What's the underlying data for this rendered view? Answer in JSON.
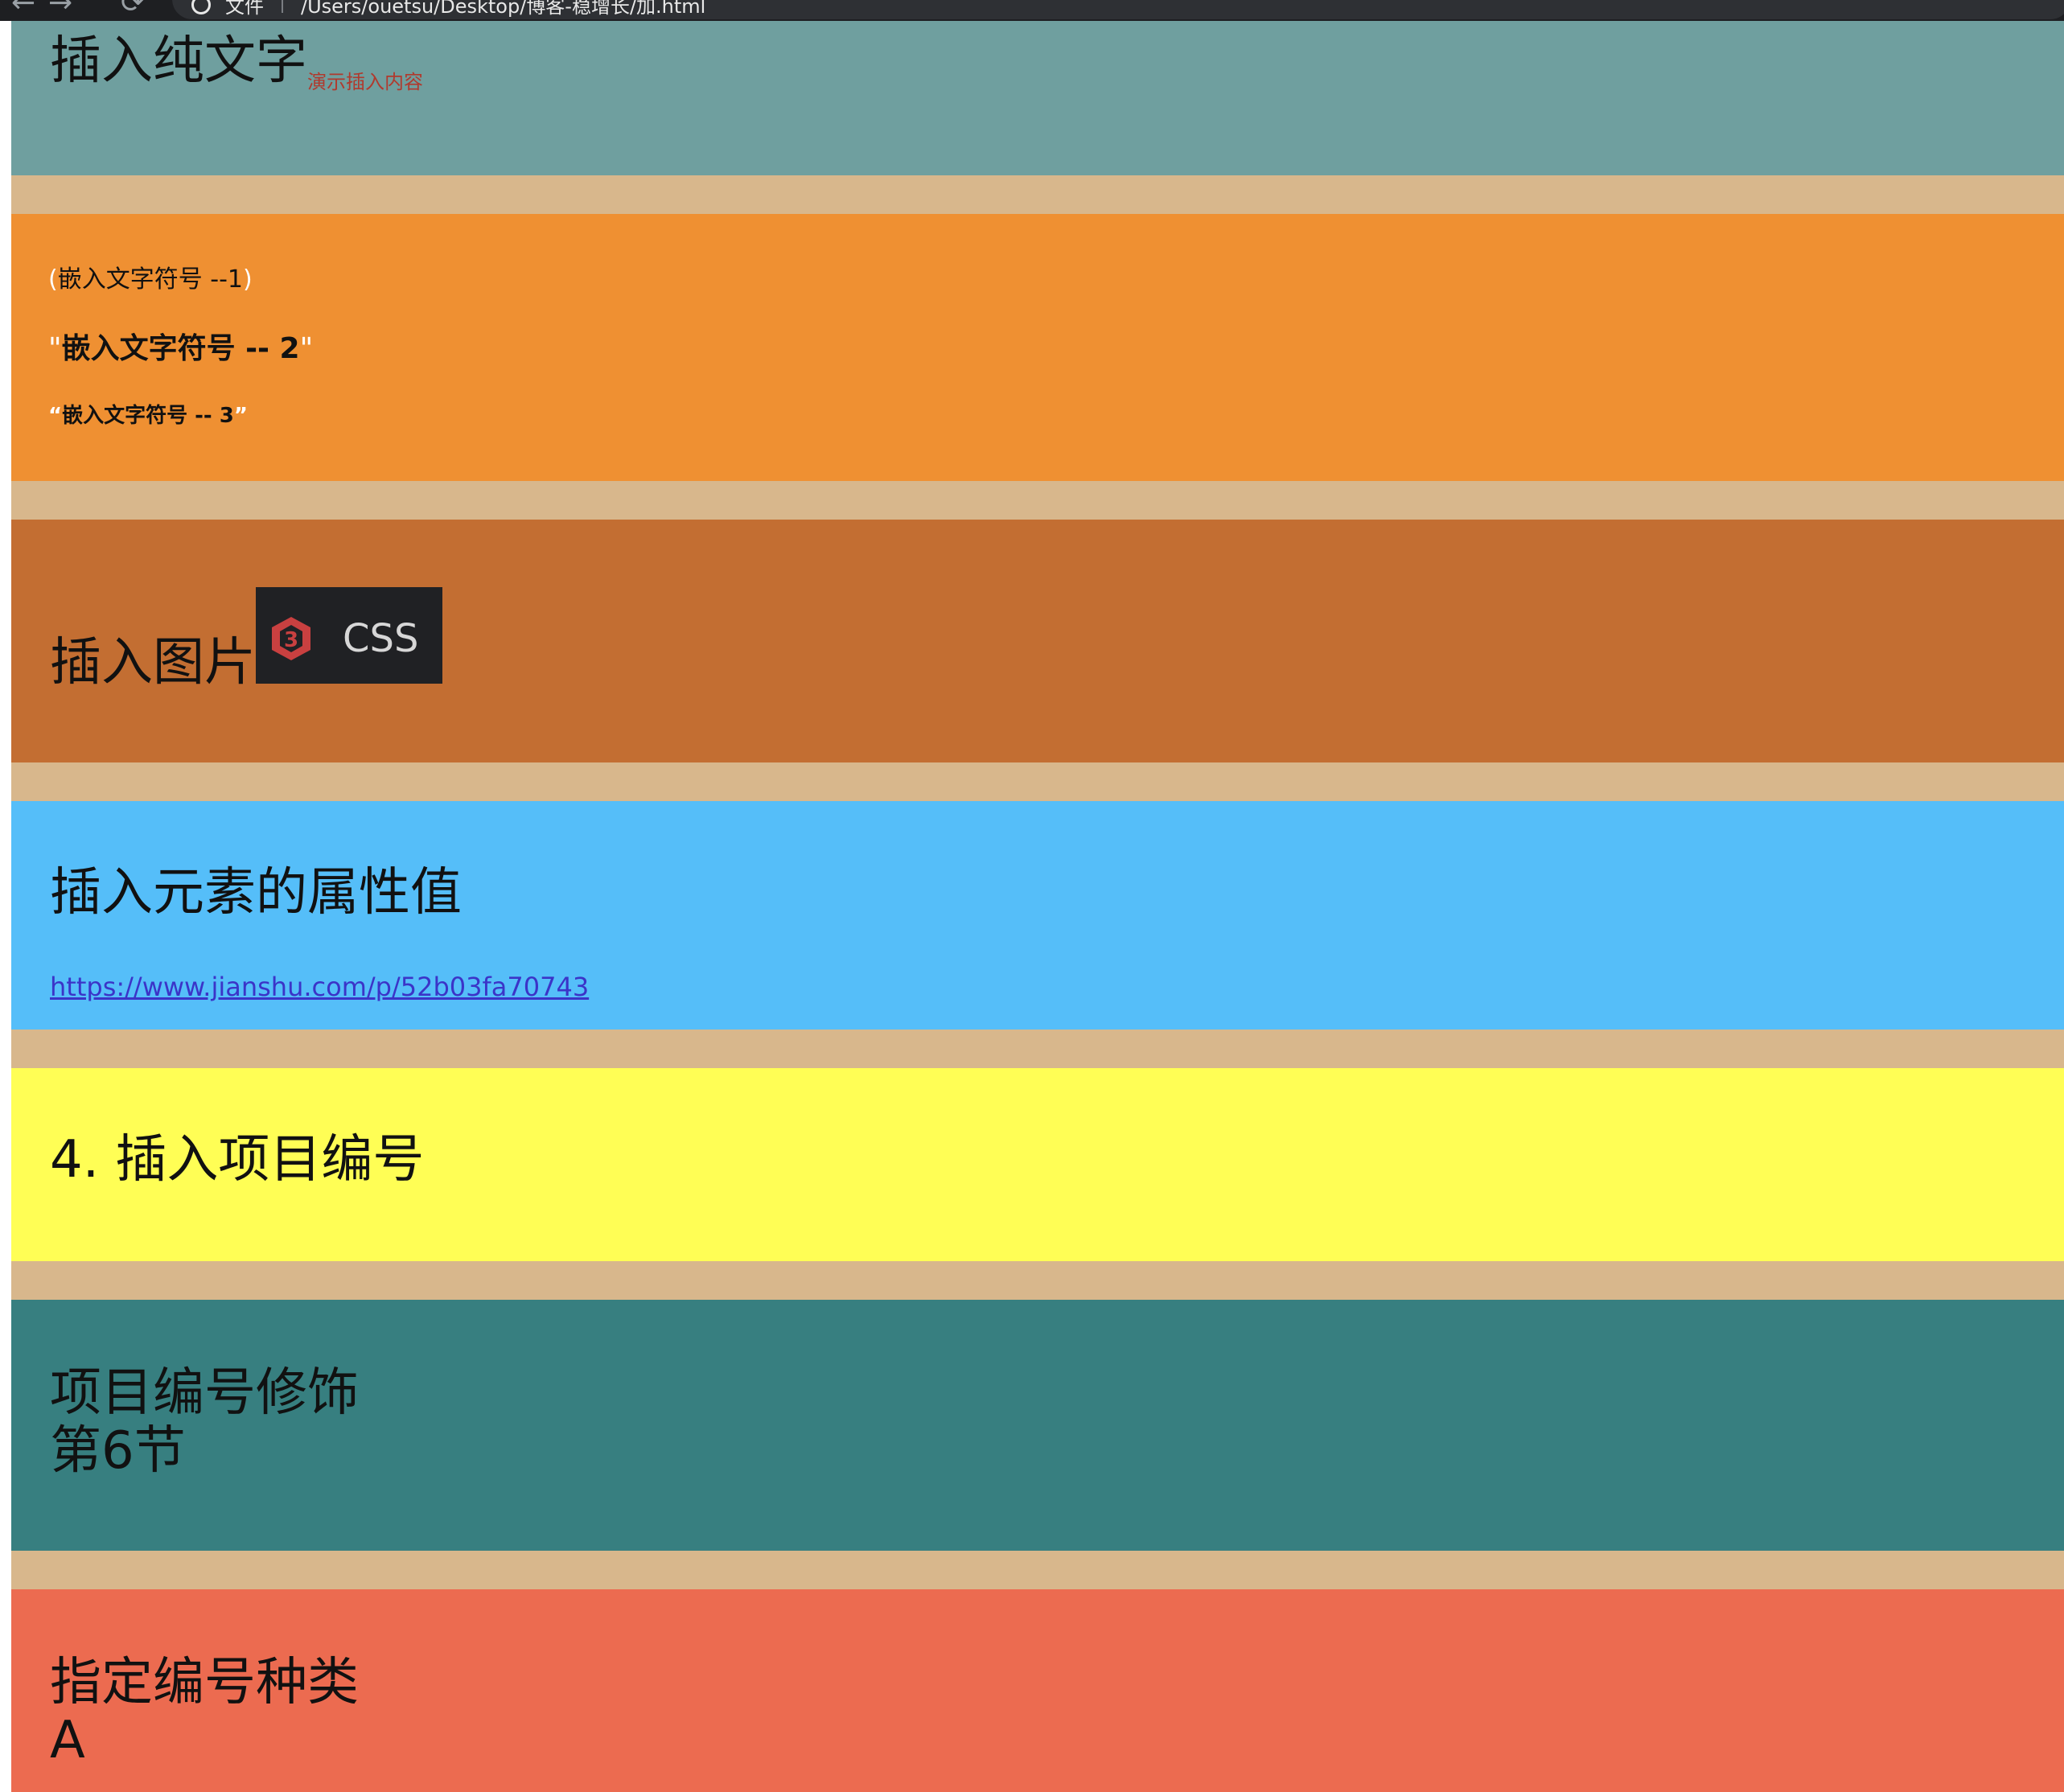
{
  "browser": {
    "address_label": "文件",
    "address_text": "/Users/ouetsu/Desktop/博客-稳增长/加.html",
    "back_glyph": "←",
    "forward_glyph": "→",
    "reload_glyph": "⟳"
  },
  "sections": {
    "insert_text": {
      "title": "插入纯文字",
      "inserted": "演示插入内容",
      "color": "#6f9f9f"
    },
    "quotes": {
      "line1": {
        "open": "(",
        "text": "嵌入文字符号 --1",
        "close": ")"
      },
      "line2": {
        "open": "\"",
        "text": "嵌入文字符号 -- 2",
        "close": "\""
      },
      "line3": {
        "open": "“",
        "text": "嵌入文字符号 -- 3",
        "close": "”"
      },
      "color": "#ef9032"
    },
    "insert_image": {
      "title": "插入图片",
      "image_text": "CSS",
      "image_icon": "css3-logo-icon",
      "color": "#c36e32"
    },
    "attr_value": {
      "title": "插入元素的属性值",
      "link": "https://www.jianshu.com/p/52b03fa70743",
      "color": "#55bef9"
    },
    "numbering": {
      "title": "4. 插入项目编号",
      "color": "#fffe55"
    },
    "numbering_decor": {
      "line1": "项目编号修饰",
      "line2": "第6节",
      "color": "#377f80"
    },
    "numbering_type": {
      "line1": "指定编号种类",
      "line2": "A",
      "color": "#ec6b50"
    }
  },
  "page_background": "#d8b78c"
}
